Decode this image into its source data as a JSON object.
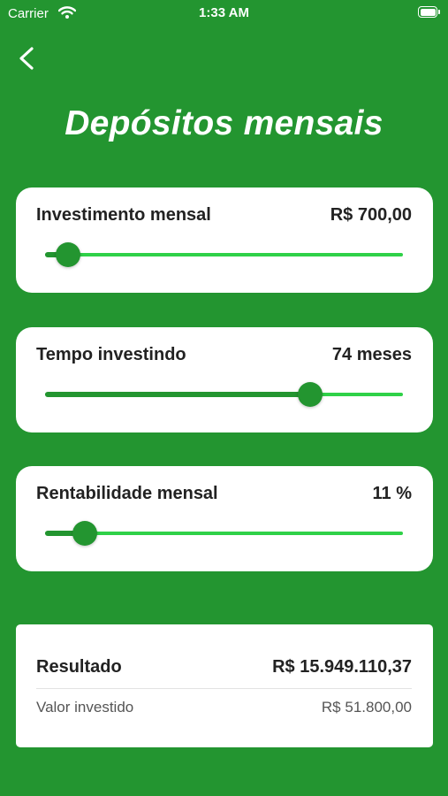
{
  "status_bar": {
    "carrier": "Carrier",
    "time": "1:33 AM"
  },
  "header": {
    "title": "Depósitos mensais"
  },
  "sliders": [
    {
      "label": "Investimento mensal",
      "value": "R$ 700,00",
      "fraction": 0.065
    },
    {
      "label": "Tempo investindo",
      "value": "74 meses",
      "fraction": 0.74
    },
    {
      "label": "Rentabilidade mensal",
      "value": "11 %",
      "fraction": 0.11
    }
  ],
  "result": {
    "label": "Resultado",
    "value": "R$ 15.949.110,37",
    "invested_label": "Valor investido",
    "invested_value": "R$ 51.800,00"
  },
  "colors": {
    "background": "#239530",
    "slider_track": "#2fd148",
    "card": "#ffffff"
  },
  "icons": [
    "wifi-icon",
    "battery-icon",
    "back-chevron-icon"
  ]
}
